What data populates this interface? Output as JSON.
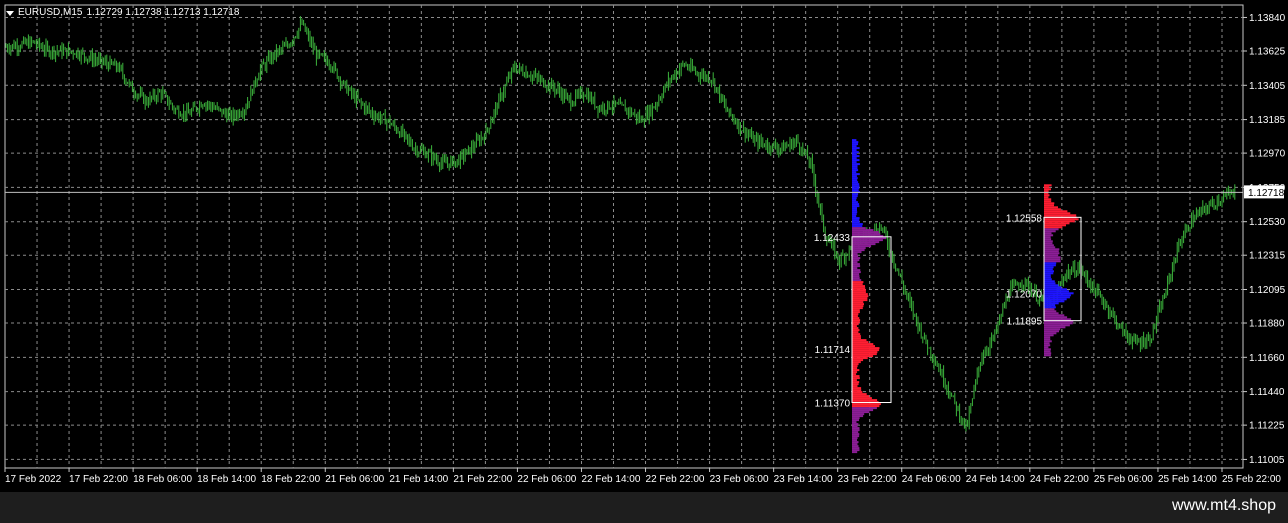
{
  "header": {
    "symbol": "EURUSD,M15",
    "ohlc": "1.12729 1.12738 1.12713 1.12718"
  },
  "watermark": "www.mt4.shop",
  "colors": {
    "background": "#000000",
    "grid": "#8c8c8c",
    "candle": "#3cb43c",
    "axis_text": "#ffffff",
    "profile_blue": "#1e14ff",
    "profile_red": "#ff1e32",
    "profile_purple": "#8c1e96"
  },
  "chart_data": {
    "type": "line",
    "y_axis": {
      "min": 1.1095,
      "max": 1.1392,
      "ticks": [
        "1.13840",
        "1.13625",
        "1.13405",
        "1.13185",
        "1.12970",
        "1.12750",
        "1.12530",
        "1.12315",
        "1.12095",
        "1.11880",
        "1.11660",
        "1.11440",
        "1.11225",
        "1.11005"
      ]
    },
    "x_axis": {
      "ticks": [
        "17 Feb 2022",
        "17 Feb 22:00",
        "18 Feb 06:00",
        "18 Feb 14:00",
        "18 Feb 22:00",
        "21 Feb 06:00",
        "21 Feb 14:00",
        "21 Feb 22:00",
        "22 Feb 06:00",
        "22 Feb 14:00",
        "22 Feb 22:00",
        "23 Feb 06:00",
        "23 Feb 14:00",
        "23 Feb 22:00",
        "24 Feb 06:00",
        "24 Feb 14:00",
        "24 Feb 22:00",
        "25 Feb 06:00",
        "25 Feb 14:00",
        "25 Feb 22:00"
      ]
    },
    "current_price": "1.12718",
    "price_path": [
      [
        0,
        1.1365
      ],
      [
        2,
        1.1368
      ],
      [
        3,
        1.1363
      ],
      [
        5,
        1.1362
      ],
      [
        6,
        1.1358
      ],
      [
        8,
        1.1352
      ],
      [
        9,
        1.1338
      ],
      [
        10,
        1.133
      ],
      [
        11,
        1.1336
      ],
      [
        12,
        1.1325
      ],
      [
        13,
        1.1322
      ],
      [
        14,
        1.133
      ],
      [
        16,
        1.132
      ],
      [
        17,
        1.1326
      ],
      [
        18,
        1.135
      ],
      [
        19,
        1.136
      ],
      [
        20,
        1.1366
      ],
      [
        21,
        1.138
      ],
      [
        22,
        1.136
      ],
      [
        23,
        1.1355
      ],
      [
        24,
        1.134
      ],
      [
        25,
        1.133
      ],
      [
        26,
        1.1322
      ],
      [
        27,
        1.1318
      ],
      [
        28,
        1.131
      ],
      [
        29,
        1.13
      ],
      [
        30,
        1.1296
      ],
      [
        31,
        1.129
      ],
      [
        32,
        1.1292
      ],
      [
        33,
        1.13
      ],
      [
        34,
        1.131
      ],
      [
        35,
        1.1332
      ],
      [
        36,
        1.1352
      ],
      [
        37,
        1.1348
      ],
      [
        38,
        1.1343
      ],
      [
        39,
        1.1338
      ],
      [
        40,
        1.133
      ],
      [
        41,
        1.1336
      ],
      [
        42,
        1.1326
      ],
      [
        43,
        1.1328
      ],
      [
        44,
        1.1325
      ],
      [
        45,
        1.1318
      ],
      [
        46,
        1.1328
      ],
      [
        47,
        1.1344
      ],
      [
        48,
        1.1354
      ],
      [
        49,
        1.1348
      ],
      [
        50,
        1.1345
      ],
      [
        51,
        1.1325
      ],
      [
        52,
        1.1314
      ],
      [
        53,
        1.1305
      ],
      [
        54,
        1.1302
      ],
      [
        55,
        1.13
      ],
      [
        56,
        1.1305
      ],
      [
        57,
        1.129
      ],
      [
        58,
        1.1245
      ],
      [
        59,
        1.1228
      ],
      [
        60,
        1.1238
      ],
      [
        61,
        1.1245
      ],
      [
        62,
        1.125
      ],
      [
        63,
        1.1225
      ],
      [
        64,
        1.12
      ],
      [
        65,
        1.1178
      ],
      [
        66,
        1.116
      ],
      [
        67,
        1.114
      ],
      [
        68,
        1.112
      ],
      [
        69,
        1.1165
      ],
      [
        70,
        1.118
      ],
      [
        71,
        1.1208
      ],
      [
        72,
        1.1215
      ],
      [
        73,
        1.1205
      ],
      [
        74,
        1.1198
      ],
      [
        75,
        1.122
      ],
      [
        76,
        1.1223
      ],
      [
        77,
        1.121
      ],
      [
        78,
        1.1198
      ],
      [
        79,
        1.1183
      ],
      [
        80,
        1.1175
      ],
      [
        81,
        1.1178
      ],
      [
        82,
        1.1205
      ],
      [
        83,
        1.1238
      ],
      [
        84,
        1.1255
      ],
      [
        85,
        1.1262
      ],
      [
        86,
        1.1268
      ],
      [
        87,
        1.1272
      ]
    ],
    "volume_profiles": [
      {
        "levels": [
          {
            "label": "1.12433",
            "price": 1.12433
          },
          {
            "label": "1.11714",
            "price": 1.11714
          },
          {
            "label": "1.11370",
            "price": 1.1137
          }
        ],
        "value_area_high": 1.12433,
        "value_area_low": 1.1137,
        "range_high": 1.1306,
        "range_low": 1.1105
      },
      {
        "levels": [
          {
            "label": "1.12558",
            "price": 1.12558
          },
          {
            "label": "1.12070",
            "price": 1.1207
          },
          {
            "label": "1.11895",
            "price": 1.11895
          }
        ],
        "value_area_high": 1.12558,
        "value_area_low": 1.11895,
        "range_high": 1.1277,
        "range_low": 1.1167
      }
    ]
  }
}
